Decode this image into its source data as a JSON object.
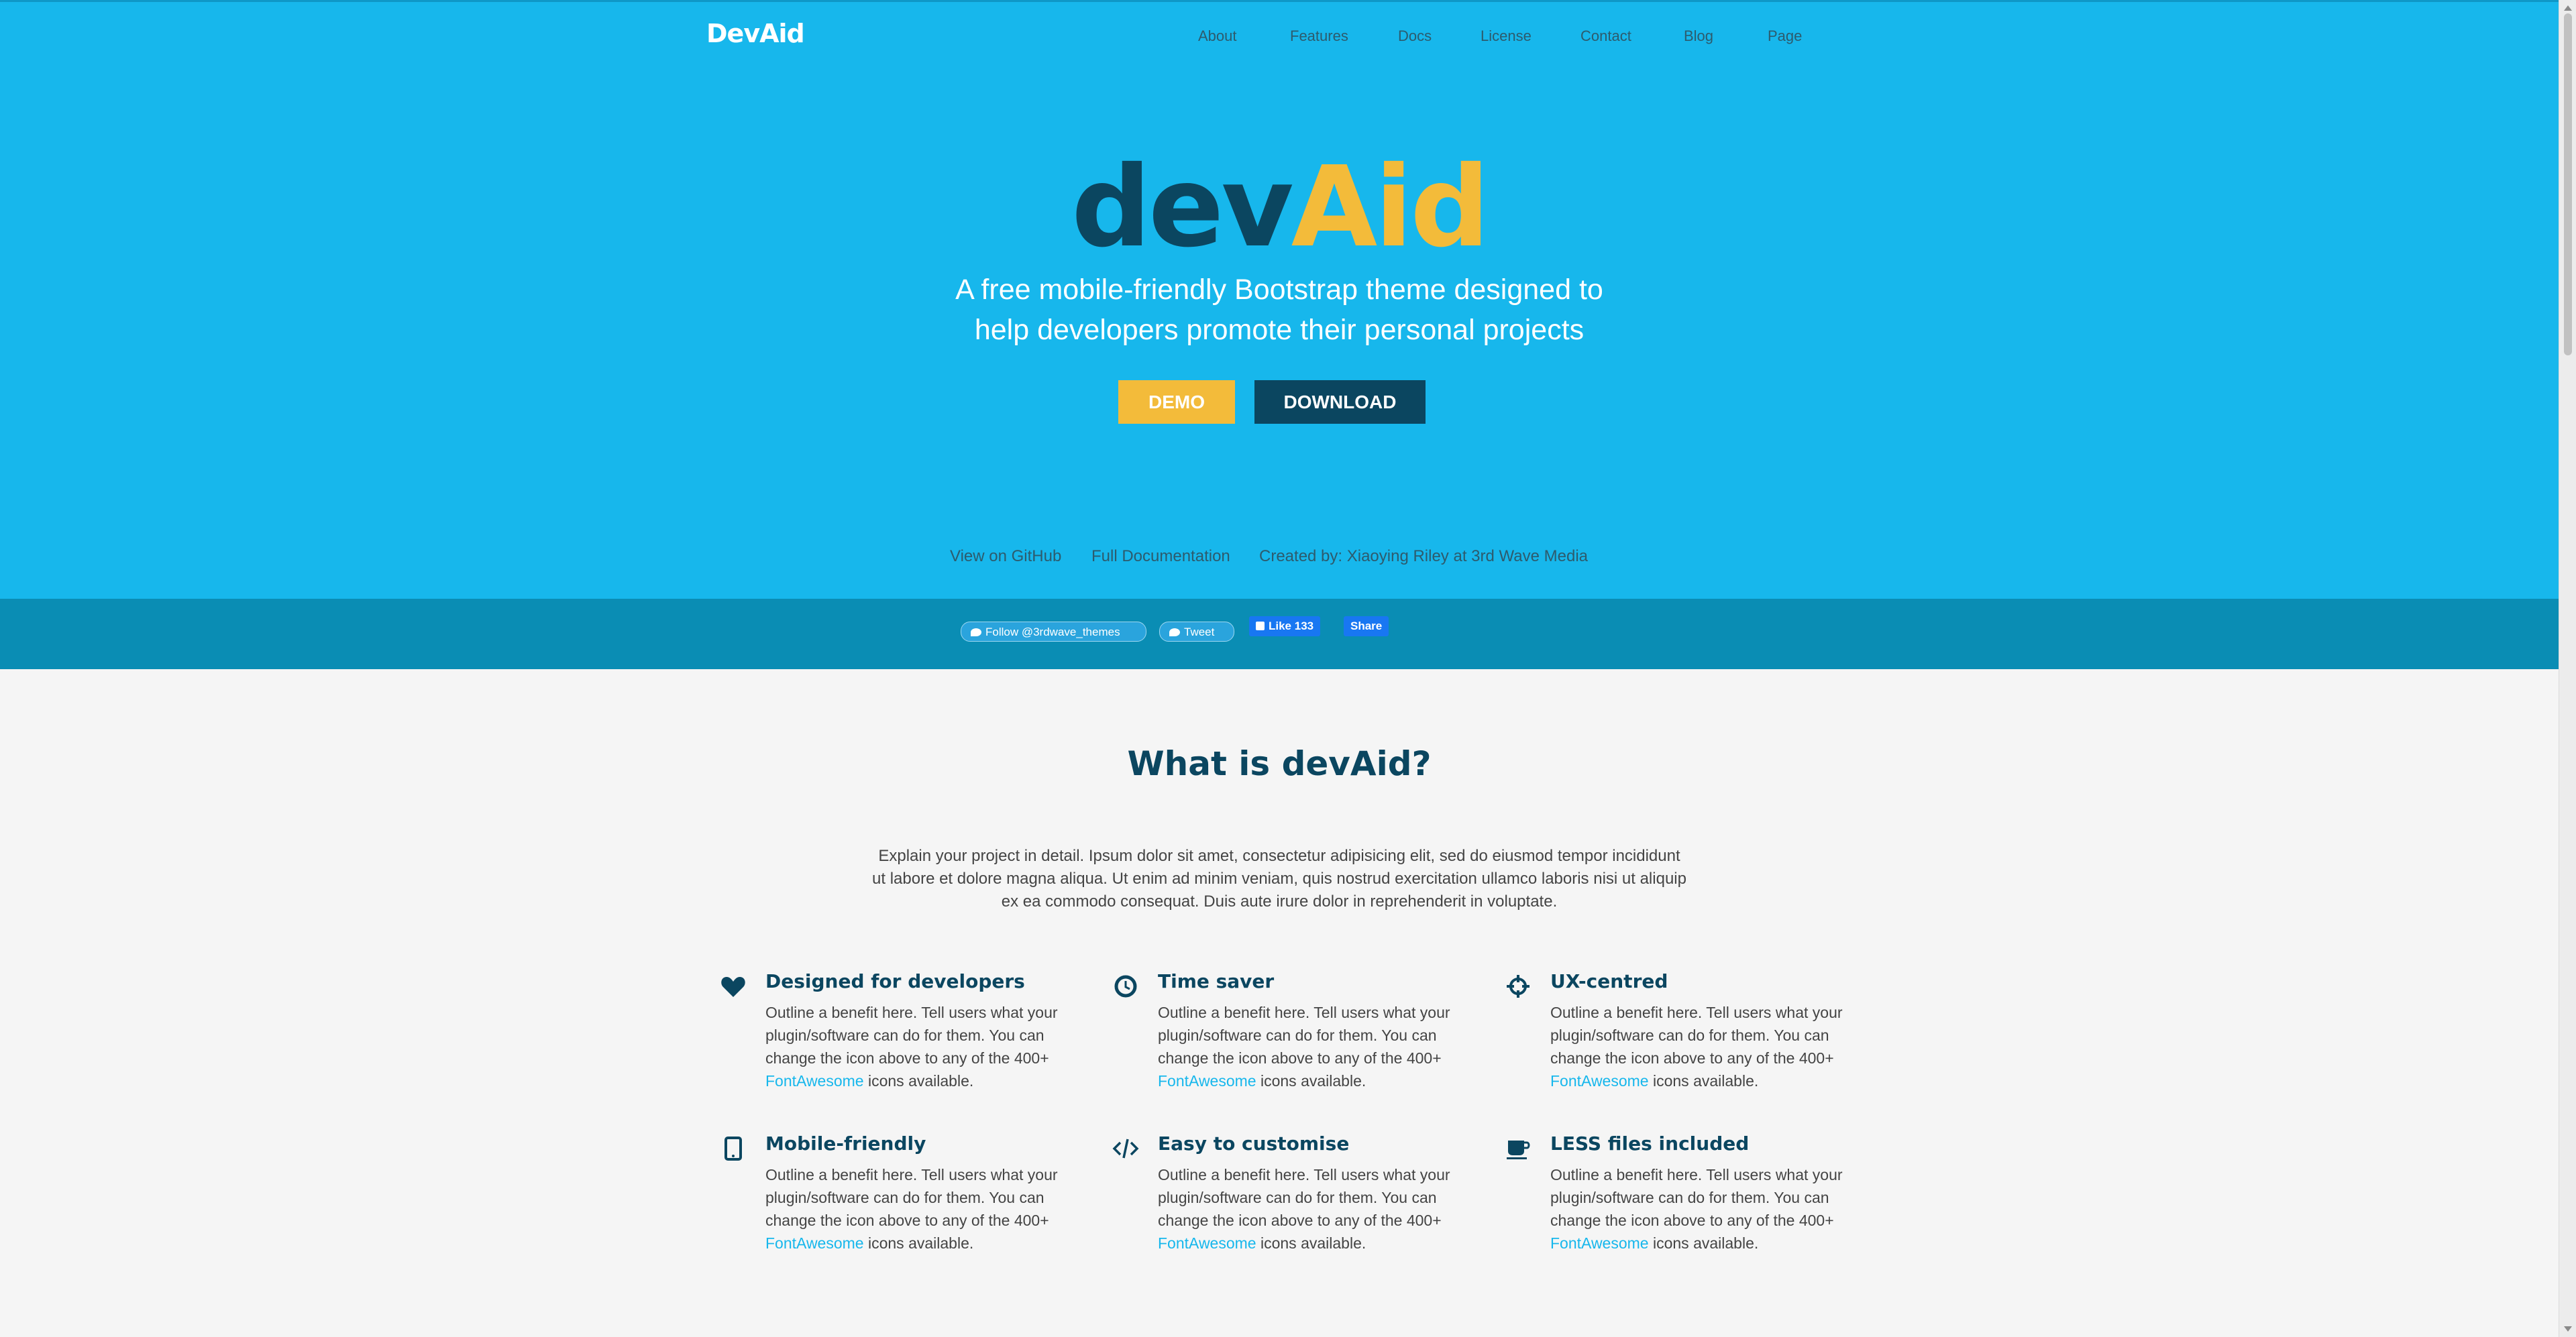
{
  "header": {
    "logo": "DevAid",
    "nav": [
      "About",
      "Features",
      "Docs",
      "License",
      "Contact",
      "Blog",
      "Page"
    ]
  },
  "hero": {
    "brand_dev": "dev",
    "brand_aid": "Aid",
    "tagline": "A free mobile-friendly Bootstrap theme designed to help developers promote their personal projects",
    "demo_label": "Demo",
    "download_label": "Download",
    "links": [
      "View on GitHub",
      "Full Documentation",
      "Created by: Xiaoying Riley at 3rd Wave Media"
    ]
  },
  "social": {
    "follow_label": "Follow @3rdwave_themes",
    "tweet_label": "Tweet",
    "like_label": "Like 133",
    "share_label": "Share"
  },
  "about": {
    "title": "What is devAid?",
    "intro": "Explain your project in detail. Ipsum dolor sit amet, consectetur adipisicing elit, sed do eiusmod tempor incididunt ut labore et dolore magna aliqua. Ut enim ad minim veniam, quis nostrud exercitation ullamco laboris nisi ut aliquip ex ea commodo consequat. Duis aute irure dolor in reprehenderit in voluptate."
  },
  "features": [
    {
      "icon": "heart-icon",
      "title": "Designed for developers",
      "text_before": "Outline a benefit here. Tell users what your plugin/software can do for them. You can change the icon above to any of the 400+ ",
      "link": "FontAwesome",
      "text_after": " icons available."
    },
    {
      "icon": "clock-icon",
      "title": "Time saver",
      "text_before": "Outline a benefit here. Tell users what your plugin/software can do for them. You can change the icon above to any of the 400+ ",
      "link": "FontAwesome",
      "text_after": " icons available."
    },
    {
      "icon": "crosshairs-icon",
      "title": "UX-centred",
      "text_before": "Outline a benefit here. Tell users what your plugin/software can do for them. You can change the icon above to any of the 400+ ",
      "link": "FontAwesome",
      "text_after": " icons available."
    },
    {
      "icon": "tablet-icon",
      "title": "Mobile-friendly",
      "text_before": "Outline a benefit here. Tell users what your plugin/software can do for them. You can change the icon above to any of the 400+ ",
      "link": "FontAwesome",
      "text_after": " icons available."
    },
    {
      "icon": "code-icon",
      "title": "Easy to customise",
      "text_before": "Outline a benefit here. Tell users what your plugin/software can do for them. You can change the icon above to any of the 400+ ",
      "link": "FontAwesome",
      "text_after": " icons available."
    },
    {
      "icon": "coffee-icon",
      "title": "LESS files included",
      "text_before": "Outline a benefit here. Tell users what your plugin/software can do for them. You can change the icon above to any of the 400+ ",
      "link": "FontAwesome",
      "text_after": " icons available."
    }
  ],
  "colors": {
    "hero_bg": "#17b7ec",
    "dark_blue": "#0b4660",
    "accent_yellow": "#f3bb3a",
    "social_bar": "#0a8db4"
  }
}
